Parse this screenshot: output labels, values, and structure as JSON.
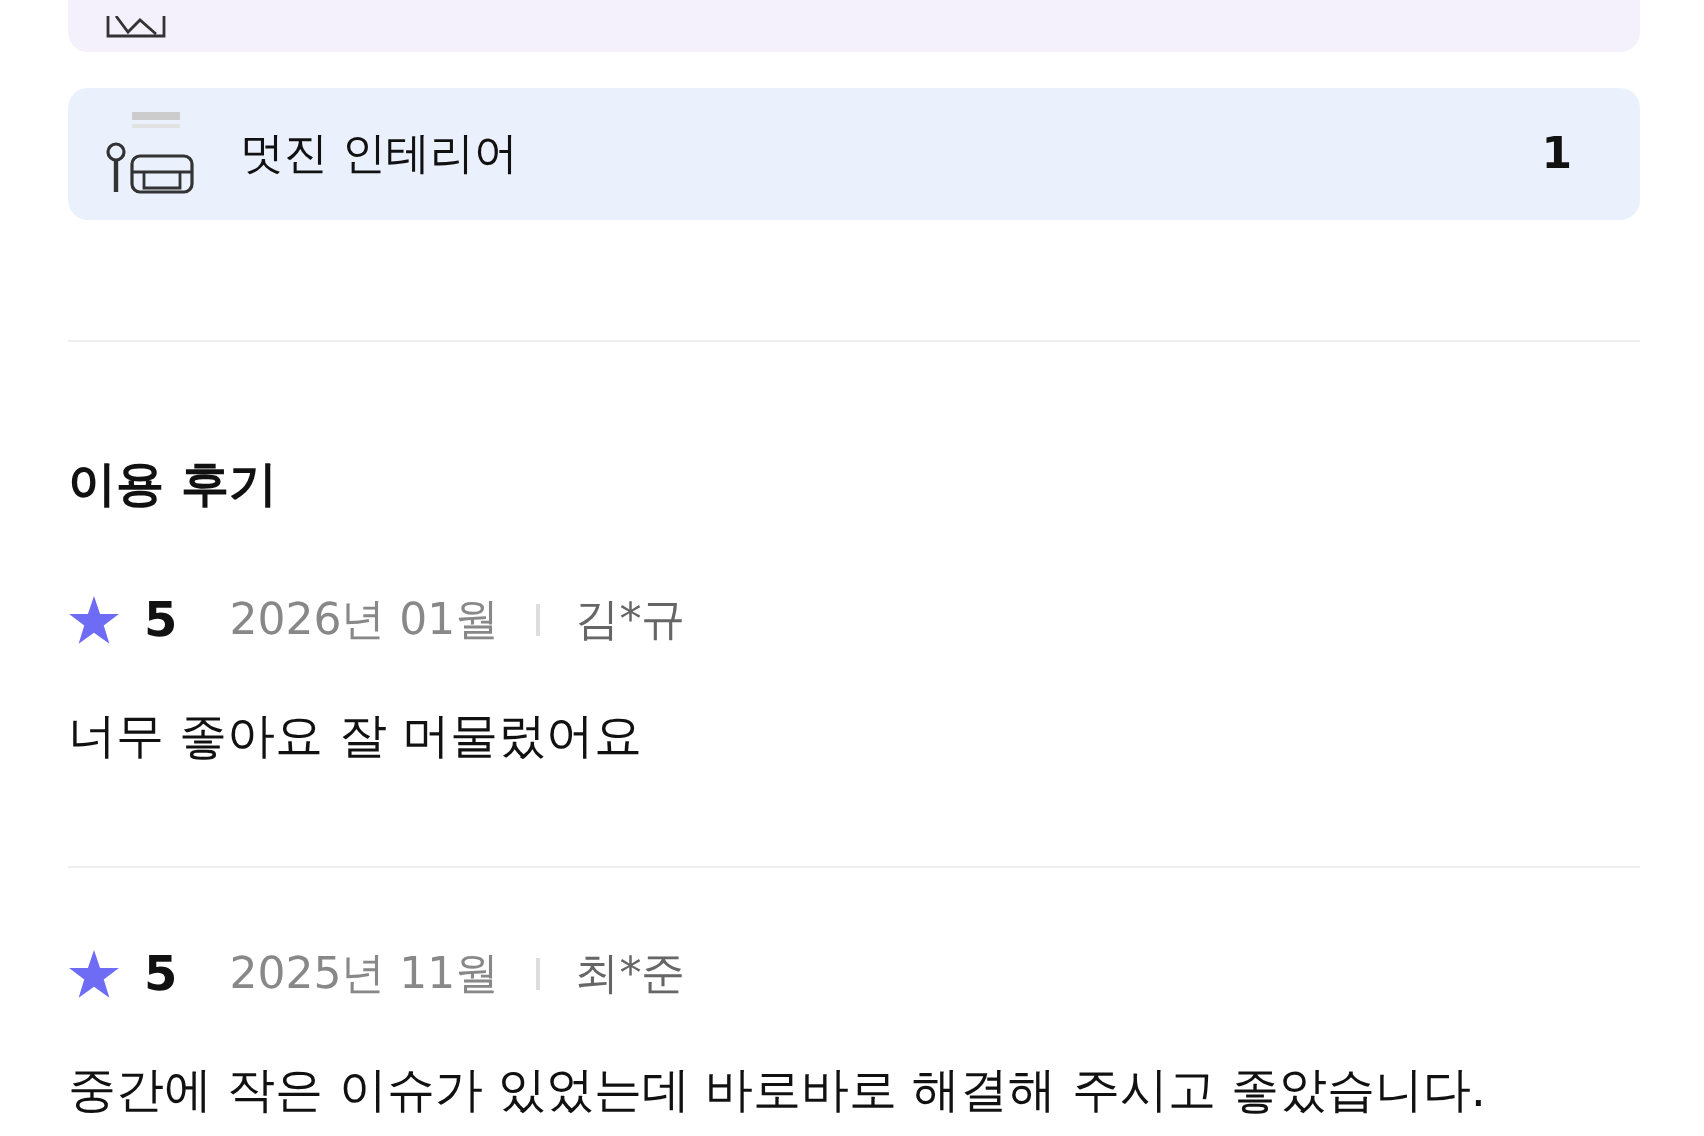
{
  "amenities": [
    {
      "kind": "cut"
    },
    {
      "kind": "interior",
      "label": "멋진 인테리어",
      "count": "1"
    }
  ],
  "reviews_section": {
    "title": "이용 후기",
    "reviews": [
      {
        "score": "5",
        "date": "2026년 01월",
        "author": "김*규",
        "text": "너무 좋아요 잘 머물렀어요"
      },
      {
        "score": "5",
        "date": "2025년 11월",
        "author": "최*준",
        "text": "중간에 작은 이슈가 있었는데  바로바로 해결해 주시고 좋았습니다."
      }
    ]
  }
}
